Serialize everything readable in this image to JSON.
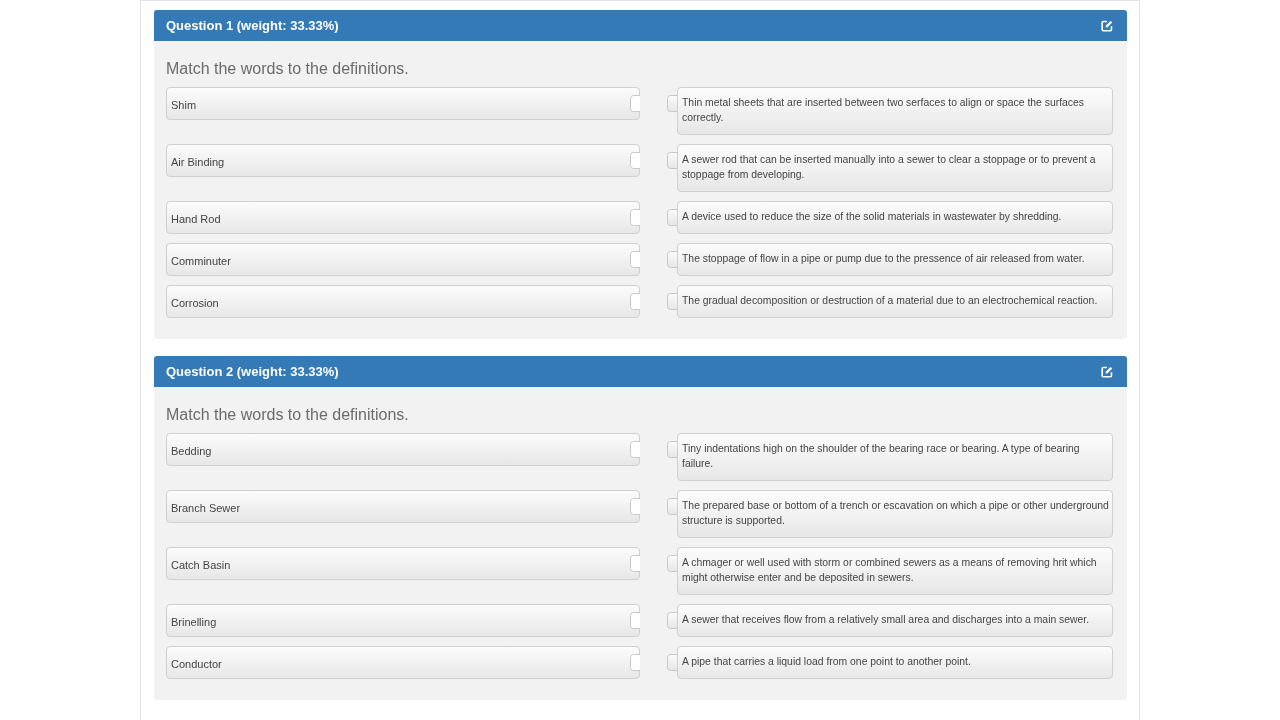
{
  "questions": [
    {
      "title": "Question 1 (weight: 33.33%)",
      "prompt": "Match the words to the definitions.",
      "rows": [
        {
          "term": "Shim",
          "definition": "Thin metal sheets that are inserted between two serfaces to align or space the surfaces correctly."
        },
        {
          "term": "Air Binding",
          "definition": "A sewer rod that can be inserted manually into a sewer to clear a stoppage or to prevent a stoppage from developing."
        },
        {
          "term": "Hand Rod",
          "definition": "A device used to reduce the size of the solid materials in wastewater by shredding."
        },
        {
          "term": "Comminuter",
          "definition": "The stoppage of flow in a pipe or pump due to the pressence of air released from water."
        },
        {
          "term": "Corrosion",
          "definition": "The gradual decomposition or destruction of a material due to an electrochemical reaction."
        }
      ]
    },
    {
      "title": "Question 2 (weight: 33.33%)",
      "prompt": "Match the words to the definitions.",
      "rows": [
        {
          "term": "Bedding",
          "definition": "Tiny indentations high on the shoulder of the bearing race or bearing. A type of bearing failure."
        },
        {
          "term": "Branch Sewer",
          "definition": "The prepared base or bottom of a trench or escavation on which a pipe or other underground structure is supported."
        },
        {
          "term": "Catch Basin",
          "definition": "A chmager or well used with storm or combined sewers as a means of removing hrit which might otherwise enter and be deposited in sewers."
        },
        {
          "term": "Brinelling",
          "definition": "A sewer that receives flow from a relatively small area and discharges into a main sewer."
        },
        {
          "term": "Conductor",
          "definition": "A pipe that carries a liquid load from one point to another point."
        }
      ]
    }
  ]
}
